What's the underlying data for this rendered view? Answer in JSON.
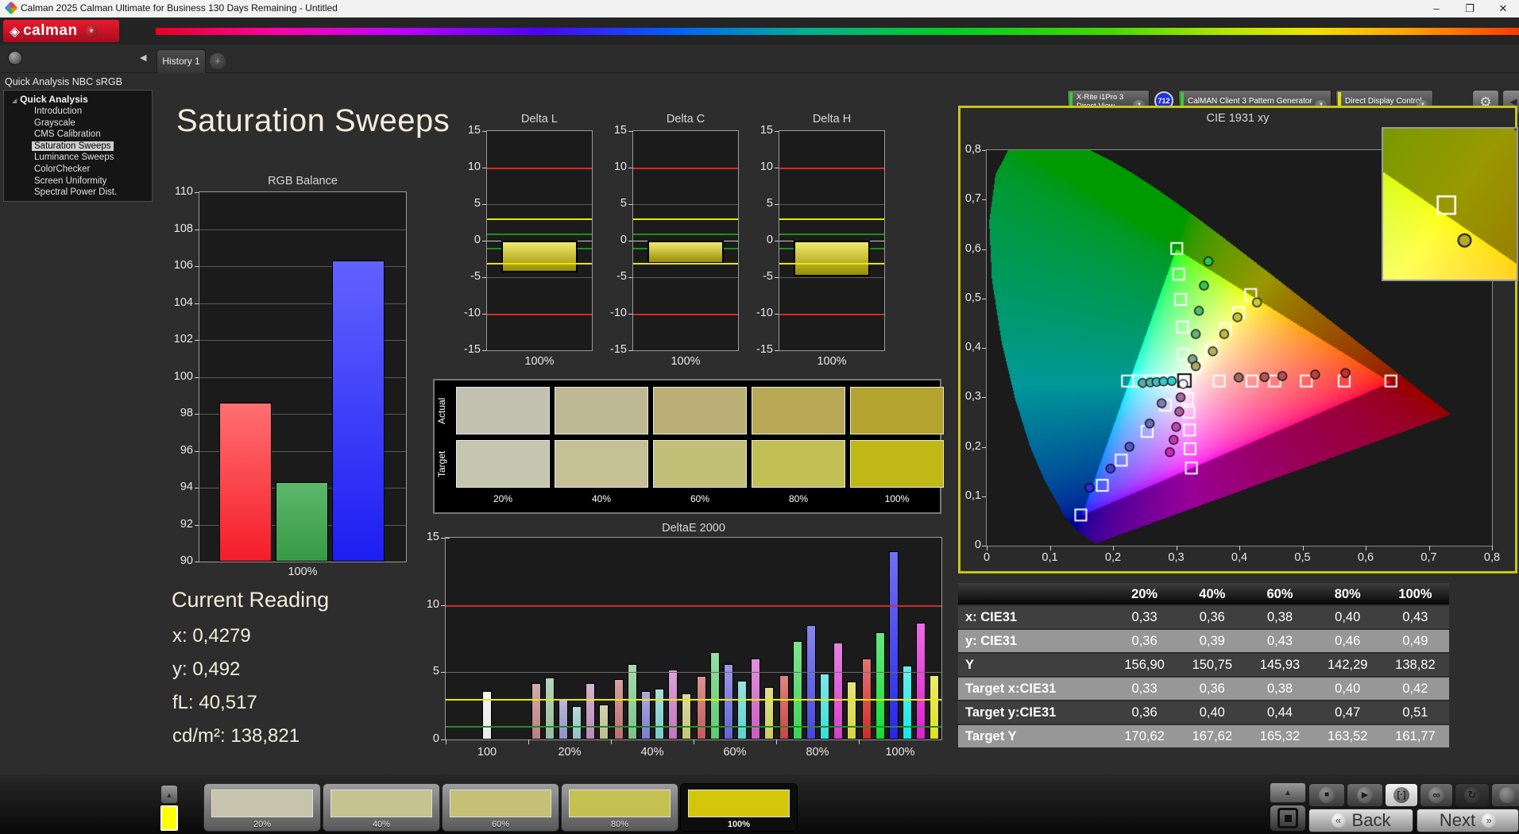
{
  "window": {
    "title": "Calman 2025 Calman Ultimate for Business 130 Days Remaining  - Untitled"
  },
  "icons": {
    "minimize": "–",
    "restore": "❐",
    "close": "✕",
    "dropdown": "▼",
    "up": "▲",
    "collapse_left": "◀",
    "collapse_right": "◀",
    "gear": "⚙",
    "play": "▶",
    "stop": "■",
    "infinity": "∞",
    "sync": "↻",
    "measure": "[·]",
    "back_chevron": "«",
    "next_chevron": "»",
    "tree_expander": "◢",
    "logo_diamond": "◈",
    "add_tab": "+"
  },
  "logo": {
    "brand": "calman"
  },
  "tabs": {
    "active": "History 1"
  },
  "toolbar": {
    "meter": {
      "line1": "X-Rite i1Pro 3",
      "line2": "Direct View",
      "badge": "712",
      "accent": "#35cc35"
    },
    "pattern_generator": {
      "label": "CalMAN Client 3 Pattern Generator",
      "accent": "#35cc35"
    },
    "display_control": {
      "label": "Direct Display Control",
      "accent": "#e2e200"
    }
  },
  "sidebar": {
    "workflow_title": "Quick Analysis NBC sRGB",
    "root": "Quick Analysis",
    "items": [
      {
        "label": "Introduction",
        "selected": false
      },
      {
        "label": "Grayscale",
        "selected": false
      },
      {
        "label": "CMS Calibration",
        "selected": false
      },
      {
        "label": "Saturation Sweeps",
        "selected": true
      },
      {
        "label": "Luminance Sweeps",
        "selected": false
      },
      {
        "label": "ColorChecker",
        "selected": false
      },
      {
        "label": "Screen Uniformity",
        "selected": false
      },
      {
        "label": "Spectral Power Dist.",
        "selected": false
      }
    ]
  },
  "page": {
    "title": "Saturation Sweeps"
  },
  "current_reading": {
    "heading": "Current Reading",
    "lines": [
      "x: 0,4279",
      "y: 0,492",
      "fL: 40,517",
      "cd/m²: 138,821"
    ]
  },
  "swatches": {
    "row_labels": [
      "Actual",
      "Target"
    ],
    "col_labels": [
      "20%",
      "40%",
      "60%",
      "80%",
      "100%"
    ],
    "actual": [
      "#c3c1b2",
      "#bfb894",
      "#bbaf78",
      "#b9a957",
      "#b4a32e"
    ],
    "target": [
      "#c6c5b0",
      "#c5c194",
      "#c2bf79",
      "#c2bf55",
      "#c0b814"
    ]
  },
  "table": {
    "headers": [
      "",
      "20%",
      "40%",
      "60%",
      "80%",
      "100%"
    ],
    "rows": [
      {
        "label": "x: CIE31",
        "shade": "dark",
        "values": [
          "0,33",
          "0,36",
          "0,38",
          "0,40",
          "0,43"
        ]
      },
      {
        "label": "y: CIE31",
        "shade": "light",
        "values": [
          "0,36",
          "0,39",
          "0,43",
          "0,46",
          "0,49"
        ]
      },
      {
        "label": "Y",
        "shade": "dark",
        "values": [
          "156,90",
          "150,75",
          "145,93",
          "142,29",
          "138,82"
        ]
      },
      {
        "label": "Target x:CIE31",
        "shade": "light",
        "values": [
          "0,33",
          "0,36",
          "0,38",
          "0,40",
          "0,42"
        ]
      },
      {
        "label": "Target y:CIE31",
        "shade": "dark",
        "values": [
          "0,36",
          "0,40",
          "0,44",
          "0,47",
          "0,51"
        ]
      },
      {
        "label": "Target Y",
        "shade": "light",
        "values": [
          "170,62",
          "167,62",
          "165,32",
          "163,52",
          "161,77"
        ]
      }
    ]
  },
  "bottom_bar": {
    "quick_color": "#ffff00",
    "patches": [
      {
        "label": "20%",
        "color": "#c6c4ac",
        "selected": false
      },
      {
        "label": "40%",
        "color": "#c7c390",
        "selected": false
      },
      {
        "label": "60%",
        "color": "#c4c075",
        "selected": false
      },
      {
        "label": "80%",
        "color": "#c5c151",
        "selected": false
      },
      {
        "label": "100%",
        "color": "#d4c70a",
        "selected": true
      }
    ]
  },
  "transport": {
    "back": "Back",
    "next": "Next"
  },
  "chart_data": [
    {
      "id": "rgb_balance",
      "type": "bar",
      "title": "RGB Balance",
      "categories": [
        "100%"
      ],
      "ylim": [
        90,
        110
      ],
      "yticks": [
        110,
        108,
        106,
        104,
        102,
        100,
        98,
        96,
        94,
        92,
        90
      ],
      "series": [
        {
          "name": "Red",
          "value": 98.6,
          "top": "#ff7070",
          "bottom": "#f51c2a"
        },
        {
          "name": "Green",
          "value": 94.3,
          "top": "#5cb86a",
          "bottom": "#379a46"
        },
        {
          "name": "Blue",
          "value": 106.3,
          "top": "#6262ff",
          "bottom": "#1d1df2"
        }
      ]
    },
    {
      "id": "delta_l",
      "type": "bar",
      "title": "Delta L",
      "categories": [
        "100%"
      ],
      "value": -4.4,
      "ylim": [
        -15,
        15
      ],
      "yticks": [
        15,
        10,
        5,
        0,
        -5,
        -10,
        -15
      ],
      "ref_lines": [
        {
          "y": 10,
          "color": "#d42a2a",
          "w": 2
        },
        {
          "y": -10,
          "color": "#d42a2a",
          "w": 2
        },
        {
          "y": 3,
          "color": "#e8e800",
          "w": 2
        },
        {
          "y": -3,
          "color": "#e8e800",
          "w": 2
        },
        {
          "y": 1,
          "color": "#1f8f1f",
          "w": 2
        },
        {
          "y": -1,
          "color": "#1f8f1f",
          "w": 2
        }
      ],
      "bar_top": "#f0ea6e",
      "bar_bottom": "#9a8e00"
    },
    {
      "id": "delta_c",
      "type": "bar",
      "title": "Delta C",
      "categories": [
        "100%"
      ],
      "value": -3.2,
      "ylim": [
        -15,
        15
      ],
      "yticks": [
        15,
        10,
        5,
        0,
        -5,
        -10,
        -15
      ],
      "ref_lines": [
        {
          "y": 10,
          "color": "#d42a2a",
          "w": 2
        },
        {
          "y": -10,
          "color": "#d42a2a",
          "w": 2
        },
        {
          "y": 3,
          "color": "#e8e800",
          "w": 2
        },
        {
          "y": -3,
          "color": "#e8e800",
          "w": 2
        },
        {
          "y": 1,
          "color": "#1f8f1f",
          "w": 2
        },
        {
          "y": -1,
          "color": "#1f8f1f",
          "w": 2
        }
      ],
      "bar_top": "#f0ea6e",
      "bar_bottom": "#9a8e00"
    },
    {
      "id": "delta_h",
      "type": "bar",
      "title": "Delta H",
      "categories": [
        "100%"
      ],
      "value": -4.9,
      "ylim": [
        -15,
        15
      ],
      "yticks": [
        15,
        10,
        5,
        0,
        -5,
        -10,
        -15
      ],
      "ref_lines": [
        {
          "y": 10,
          "color": "#d42a2a",
          "w": 2
        },
        {
          "y": -10,
          "color": "#d42a2a",
          "w": 2
        },
        {
          "y": 3,
          "color": "#e8e800",
          "w": 2
        },
        {
          "y": -3,
          "color": "#e8e800",
          "w": 2
        },
        {
          "y": 1,
          "color": "#1f8f1f",
          "w": 2
        },
        {
          "y": -1,
          "color": "#1f8f1f",
          "w": 2
        }
      ],
      "bar_top": "#f0ea6e",
      "bar_bottom": "#9a8e00"
    },
    {
      "id": "deltae2000",
      "type": "bar",
      "title": "DeltaE 2000",
      "ylim": [
        0,
        15
      ],
      "yticks": [
        15,
        10,
        5,
        0
      ],
      "ref_lines": [
        {
          "y": 10,
          "color": "#d42a2a",
          "w": 2
        },
        {
          "y": 5,
          "color": "#6a6a6a",
          "w": 1
        },
        {
          "y": 3,
          "color": "#e8e800",
          "w": 2
        },
        {
          "y": 1,
          "color": "#1f8f1f",
          "w": 2
        }
      ],
      "groups": [
        {
          "label": "100",
          "bars": [
            {
              "value": 3.6,
              "color": "#ececec"
            }
          ]
        },
        {
          "label": "20%",
          "bars": [
            {
              "value": 4.2,
              "color": "#b98080"
            },
            {
              "value": 4.6,
              "color": "#93bd9a"
            },
            {
              "value": 3.0,
              "color": "#9191c4"
            },
            {
              "value": 2.5,
              "color": "#93c2c2"
            },
            {
              "value": 4.2,
              "color": "#bd8ab8"
            },
            {
              "value": 2.6,
              "color": "#bdbd8a"
            }
          ]
        },
        {
          "label": "40%",
          "bars": [
            {
              "value": 4.5,
              "color": "#bd6e6e"
            },
            {
              "value": 5.6,
              "color": "#7ac487"
            },
            {
              "value": 3.6,
              "color": "#7d7dcc"
            },
            {
              "value": 3.8,
              "color": "#7acaca"
            },
            {
              "value": 5.2,
              "color": "#c574be"
            },
            {
              "value": 3.4,
              "color": "#c5c574"
            }
          ]
        },
        {
          "label": "60%",
          "bars": [
            {
              "value": 4.7,
              "color": "#c35a5a"
            },
            {
              "value": 6.5,
              "color": "#5ccc70"
            },
            {
              "value": 5.6,
              "color": "#6363d6"
            },
            {
              "value": 4.4,
              "color": "#5cd3d3"
            },
            {
              "value": 6.0,
              "color": "#cd5ac5"
            },
            {
              "value": 3.9,
              "color": "#cdcd5a"
            }
          ]
        },
        {
          "label": "80%",
          "bars": [
            {
              "value": 4.8,
              "color": "#c94444"
            },
            {
              "value": 7.3,
              "color": "#3bd456"
            },
            {
              "value": 8.5,
              "color": "#4646e0"
            },
            {
              "value": 4.9,
              "color": "#3bdcdc"
            },
            {
              "value": 7.2,
              "color": "#d63ecc"
            },
            {
              "value": 4.3,
              "color": "#d6d63e"
            }
          ]
        },
        {
          "label": "100%",
          "bars": [
            {
              "value": 6.0,
              "color": "#d02b2b"
            },
            {
              "value": 8.0,
              "color": "#14dd38"
            },
            {
              "value": 14.0,
              "color": "#2525ec"
            },
            {
              "value": 5.5,
              "color": "#17e6e6"
            },
            {
              "value": 8.7,
              "color": "#e01fd3"
            },
            {
              "value": 4.8,
              "color": "#e0e01f"
            }
          ]
        }
      ]
    },
    {
      "id": "cie1931",
      "type": "scatter",
      "title": "CIE 1931 xy",
      "xlim": [
        0,
        0.8
      ],
      "ylim": [
        0,
        0.8
      ],
      "xtick_labels": [
        "0",
        "0,1",
        "0,2",
        "0,3",
        "0,4",
        "0,5",
        "0,6",
        "0,7",
        "0,8"
      ],
      "ytick_labels": [
        "0",
        "0,1",
        "0,2",
        "0,3",
        "0,4",
        "0,5",
        "0,6",
        "0,7",
        "0,8"
      ],
      "srgb_triangle": [
        [
          0.64,
          0.33
        ],
        [
          0.3,
          0.6
        ],
        [
          0.15,
          0.06
        ]
      ],
      "white_target": {
        "x": 0.313,
        "y": 0.334
      },
      "white_measured": {
        "x": 0.311,
        "y": 0.327,
        "color": "#f2f2f2"
      },
      "targets": [
        {
          "x": 0.368,
          "y": 0.333
        },
        {
          "x": 0.42,
          "y": 0.333
        },
        {
          "x": 0.456,
          "y": 0.333
        },
        {
          "x": 0.506,
          "y": 0.333
        },
        {
          "x": 0.566,
          "y": 0.333
        },
        {
          "x": 0.64,
          "y": 0.333
        },
        {
          "x": 0.311,
          "y": 0.387
        },
        {
          "x": 0.31,
          "y": 0.442
        },
        {
          "x": 0.307,
          "y": 0.498
        },
        {
          "x": 0.304,
          "y": 0.549
        },
        {
          "x": 0.301,
          "y": 0.601
        },
        {
          "x": 0.283,
          "y": 0.284
        },
        {
          "x": 0.254,
          "y": 0.231
        },
        {
          "x": 0.213,
          "y": 0.173
        },
        {
          "x": 0.183,
          "y": 0.122
        },
        {
          "x": 0.149,
          "y": 0.062
        },
        {
          "x": 0.294,
          "y": 0.333
        },
        {
          "x": 0.277,
          "y": 0.333
        },
        {
          "x": 0.26,
          "y": 0.333
        },
        {
          "x": 0.241,
          "y": 0.333
        },
        {
          "x": 0.223,
          "y": 0.333
        },
        {
          "x": 0.318,
          "y": 0.297
        },
        {
          "x": 0.32,
          "y": 0.27
        },
        {
          "x": 0.321,
          "y": 0.234
        },
        {
          "x": 0.322,
          "y": 0.196
        },
        {
          "x": 0.324,
          "y": 0.157
        },
        {
          "x": 0.33,
          "y": 0.361
        },
        {
          "x": 0.356,
          "y": 0.397
        },
        {
          "x": 0.378,
          "y": 0.438
        },
        {
          "x": 0.399,
          "y": 0.471
        },
        {
          "x": 0.418,
          "y": 0.508
        }
      ],
      "measurements": [
        {
          "x": 0.399,
          "y": 0.34,
          "color": "#a06a6a"
        },
        {
          "x": 0.44,
          "y": 0.341,
          "color": "#a85e5e"
        },
        {
          "x": 0.468,
          "y": 0.343,
          "color": "#b15050"
        },
        {
          "x": 0.52,
          "y": 0.346,
          "color": "#bb4040"
        },
        {
          "x": 0.568,
          "y": 0.349,
          "color": "#c43030"
        },
        {
          "x": 0.326,
          "y": 0.377,
          "color": "#7ba887"
        },
        {
          "x": 0.331,
          "y": 0.428,
          "color": "#68b07a"
        },
        {
          "x": 0.336,
          "y": 0.475,
          "color": "#52b96a"
        },
        {
          "x": 0.344,
          "y": 0.526,
          "color": "#3cc159"
        },
        {
          "x": 0.351,
          "y": 0.575,
          "color": "#24ca47"
        },
        {
          "x": 0.277,
          "y": 0.288,
          "color": "#7d7dae"
        },
        {
          "x": 0.258,
          "y": 0.247,
          "color": "#6a6ab8"
        },
        {
          "x": 0.226,
          "y": 0.2,
          "color": "#5555c3"
        },
        {
          "x": 0.196,
          "y": 0.156,
          "color": "#4040ce"
        },
        {
          "x": 0.163,
          "y": 0.117,
          "color": "#2b2bd9"
        },
        {
          "x": 0.247,
          "y": 0.329,
          "color": "#62a8a8"
        },
        {
          "x": 0.259,
          "y": 0.33,
          "color": "#55b2b2"
        },
        {
          "x": 0.269,
          "y": 0.331,
          "color": "#47bcbc"
        },
        {
          "x": 0.28,
          "y": 0.332,
          "color": "#38c6c6"
        },
        {
          "x": 0.293,
          "y": 0.333,
          "color": "#28d0d0"
        },
        {
          "x": 0.307,
          "y": 0.3,
          "color": "#a6699e"
        },
        {
          "x": 0.305,
          "y": 0.271,
          "color": "#b059a4"
        },
        {
          "x": 0.3,
          "y": 0.24,
          "color": "#ba48ab"
        },
        {
          "x": 0.296,
          "y": 0.214,
          "color": "#c437b1"
        },
        {
          "x": 0.29,
          "y": 0.189,
          "color": "#ce26b8"
        },
        {
          "x": 0.331,
          "y": 0.363,
          "color": "#a8a86a"
        },
        {
          "x": 0.358,
          "y": 0.393,
          "color": "#b0b05c"
        },
        {
          "x": 0.376,
          "y": 0.428,
          "color": "#b9b94e"
        },
        {
          "x": 0.397,
          "y": 0.462,
          "color": "#c1c140"
        },
        {
          "x": 0.428,
          "y": 0.492,
          "color": "#caca30"
        }
      ],
      "inset": {
        "x0": 0.392,
        "x1": 0.451,
        "y0": 0.472,
        "y1": 0.549,
        "target": {
          "x": 0.42,
          "y": 0.51
        },
        "measured": {
          "x": 0.428,
          "y": 0.492,
          "color": "#b2aa28"
        }
      }
    }
  ]
}
